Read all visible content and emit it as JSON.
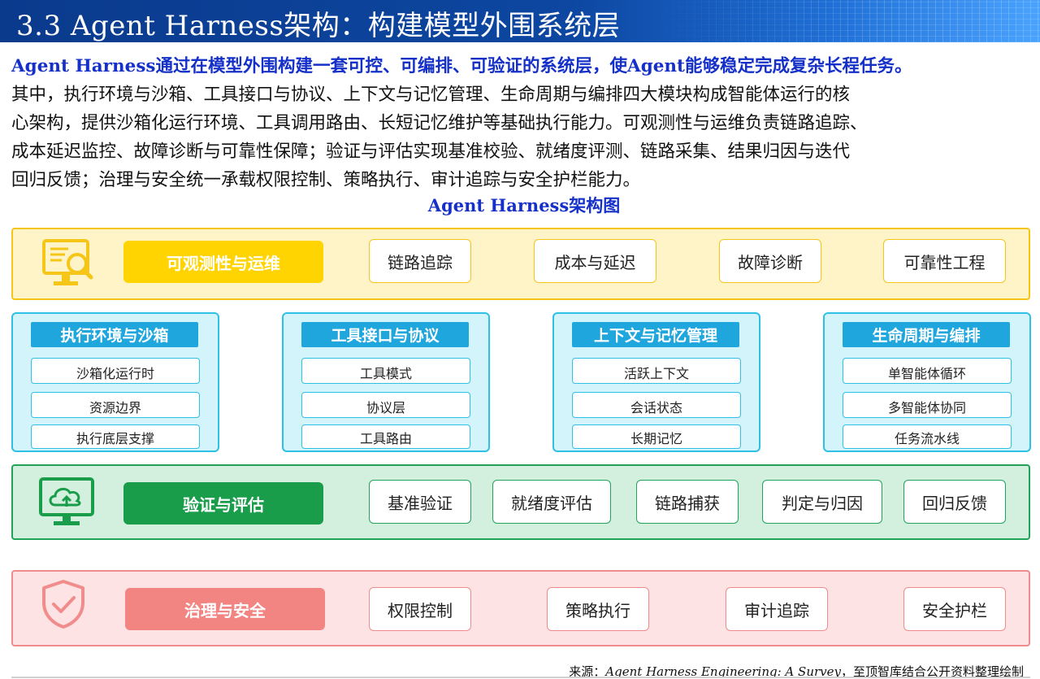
{
  "header": {
    "title": "3.3 Agent Harness架构：构建模型外围系统层"
  },
  "intro": {
    "lead": "Agent Harness通过在模型外围构建一套可控、可编排、可验证的系统层，使Agent能够稳定完成复杂长程任务。",
    "line1": "其中，执行环境与沙箱、工具接口与协议、上下文与记忆管理、生命周期与编排四大模块构成智能体运行的核",
    "line2": "心架构，提供沙箱化运行环境、工具调用路由、长短记忆维护等基础执行能力。可观测性与运维负责链路追踪、",
    "line3": "成本延迟监控、故障诊断与可靠性保障；验证与评估实现基准校验、就绪度评测、链路采集、结果归因与迭代",
    "line4": "回归反馈；治理与安全统一承载权限控制、策略执行、审计追踪与安全护栏能力。"
  },
  "diagram_title": "Agent Harness架构图",
  "observability": {
    "label": "可观测性与运维",
    "items": [
      "链路追踪",
      "成本与延迟",
      "故障诊断",
      "可靠性工程"
    ],
    "color": "#ffd400"
  },
  "modules": [
    {
      "title": "执行环境与沙箱",
      "items": [
        "沙箱化运行时",
        "资源边界",
        "执行底层支撑"
      ]
    },
    {
      "title": "工具接口与协议",
      "items": [
        "工具模式",
        "协议层",
        "工具路由"
      ]
    },
    {
      "title": "上下文与记忆管理",
      "items": [
        "活跃上下文",
        "会话状态",
        "长期记忆"
      ]
    },
    {
      "title": "生命周期与编排",
      "items": [
        "单智能体循环",
        "多智能体协同",
        "任务流水线"
      ]
    }
  ],
  "evaluation": {
    "label": "验证与评估",
    "items": [
      "基准验证",
      "就绪度评估",
      "链路捕获",
      "判定与归因",
      "回归反馈"
    ],
    "color": "#1a9d4a"
  },
  "governance": {
    "label": "治理与安全",
    "items": [
      "权限控制",
      "策略执行",
      "审计追踪",
      "安全护栏"
    ],
    "color": "#f28482"
  },
  "source": {
    "prefix": "来源：",
    "work": "Agent Harness Engineering: A Survey",
    "suffix": "，至顶智库结合公开资料整理绘制"
  }
}
